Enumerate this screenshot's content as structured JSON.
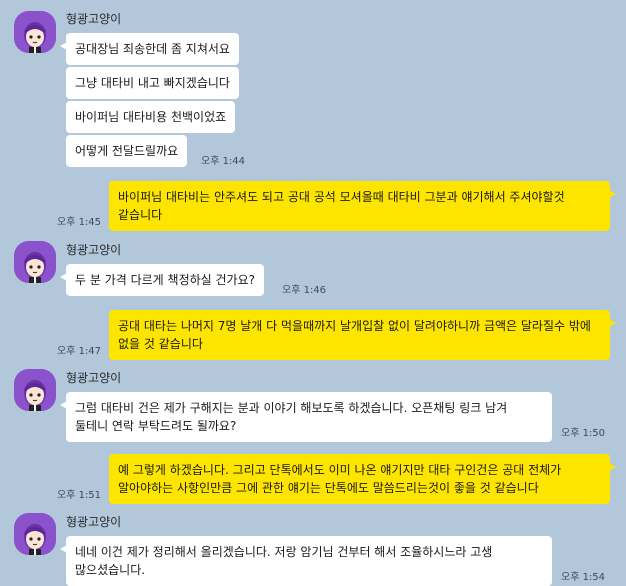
{
  "chat": {
    "groups": [
      {
        "sender": "형광고양이",
        "messages": [
          "공대장님 죄송한데 좀 지쳐서요",
          "그냥 대타비 내고 빠지겠습니다",
          "바이퍼님 대타비용 천백이었죠",
          "어떻게 전달드릴까요"
        ],
        "time": "오후 1:44"
      },
      {
        "mine": true,
        "text": "바이퍼님 대타비는 안주셔도 되고 공대 공석 모셔올때 대타비 그분과 얘기해서 주셔야할것 같습니다",
        "time": "오후 1:45"
      },
      {
        "sender": "형광고양이",
        "messages": [
          "두 분 가격 다르게 책정하실 건가요?"
        ],
        "time": "오후 1:46"
      },
      {
        "mine": true,
        "text": "공대 대타는 나머지 7명 날개 다 먹을때까지 날개입찰 없이 달려야하니까 금액은 달라질수 밖에 없을 것 같습니다",
        "time": "오후 1:47"
      },
      {
        "sender": "형광고양이",
        "messages": [
          "그럼 대타비 건은 제가 구해지는 분과 이야기 해보도록 하겠습니다. 오픈채팅 링크 남겨 둘테니 연락 부탁드려도 될까요?"
        ],
        "time": "오후 1:50"
      },
      {
        "mine": true,
        "text": "예 그렇게 하겠습니다. 그리고 단톡에서도 이미 나온 얘기지만 대타 구인건은 공대 전체가 알아야하는 사항인만큼 그에 관한 얘기는 단톡에도 말씀드리는것이 좋을 것 같습니다",
        "time": "오후 1:51"
      },
      {
        "sender": "형광고양이",
        "messages": [
          "네네 이건 제가 정리해서 올리겠습니다. 저랑 암기님 건부터 해서 조율하시느라 고생 많으셨습니다."
        ],
        "time": "오후 1:54"
      }
    ]
  }
}
